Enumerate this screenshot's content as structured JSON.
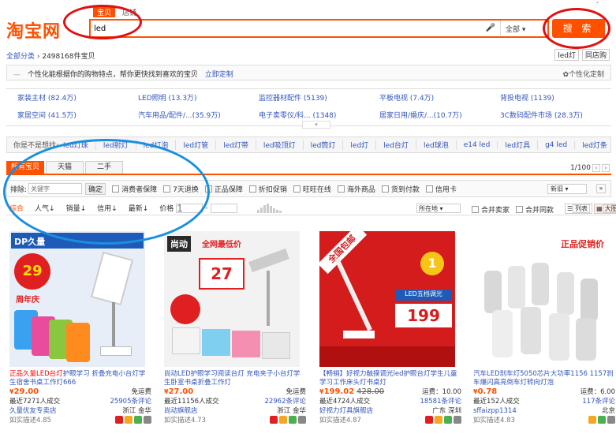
{
  "header": {
    "logo": "淘宝网",
    "search_tabs": [
      "宝贝",
      "店铺"
    ],
    "query": "led",
    "scope": "全部",
    "search_button": "搜 索"
  },
  "breadcrumb": {
    "root": "全部分类",
    "count": "2498168件宝贝"
  },
  "tags": [
    "led灯",
    "同店购"
  ],
  "personal": {
    "text": "个性化能根据你的购物特点，帮你更快找到喜欢的宝贝",
    "link": "立即定制",
    "right": "个性化定制"
  },
  "categories": [
    "家装主材 (82.4万)",
    "LED照明 (13.3万)",
    "监控器材配件 (5139)",
    "平板电视 (7.4万)",
    "背投电视 (1139)",
    "家居空间 (41.5万)",
    "汽车用品/配件/...(35.9万)",
    "电子卖零仪/科... (1348)",
    "居家日用/婚庆/...(10.7万)",
    "3C数码配件市场 (28.3万)"
  ],
  "suggest": {
    "label": "你是不是想找:",
    "items": [
      "led灯珠",
      "led射灯",
      "led灯泡",
      "led灯管",
      "led灯带",
      "led吸顶灯",
      "led筒灯",
      "led灯",
      "led台灯",
      "led球泡",
      "e14 led",
      "led灯具",
      "g4 led",
      "led灯条"
    ]
  },
  "result_tabs": [
    "所有宝贝",
    "天猫",
    "二手"
  ],
  "pager": "1/100",
  "filter": {
    "exclude_label": "排除:",
    "exclude_placeholder": "关键字",
    "ok": "确定",
    "options": [
      "消费者保障",
      "7天退换",
      "正品保障",
      "折扣促销",
      "旺旺在线",
      "海外商品",
      "货到付款",
      "信用卡"
    ],
    "new_old": "新旧"
  },
  "sort": {
    "items": [
      "综合",
      "人气",
      "销量",
      "信用",
      "最新"
    ],
    "price_label": "价格",
    "price_from": "1",
    "location": "所在地",
    "merge_seller": "合并卖家",
    "merge_same": "合并同款",
    "view_list": "列表",
    "view_big": "大图"
  },
  "products": [
    {
      "title_hl": "正品久量LED台灯",
      "title_rest": "护眼学习 折叠充电小台灯学生宿舍书桌工作灯666",
      "price": "29.00",
      "old_price": "",
      "shipping": "免运费",
      "sales": "最近7271人成交",
      "reviews": "25905条评论",
      "shop": "久量优友专卖店",
      "location": "浙江 金华",
      "rating": "如实描述4.85",
      "promo_badge": "29",
      "promo_text": "周年庆",
      "banner": "DP久量"
    },
    {
      "title_hl": "",
      "title_rest": "尚动LED护眼学习阅读台灯 充电夹子小台灯学生卧室书桌折叠工作灯",
      "price": "27.00",
      "old_price": "",
      "shipping": "免运费",
      "sales": "最近11156人成交",
      "reviews": "22962条评论",
      "shop": "尚动旗舰店",
      "location": "浙江 金华",
      "rating": "如实描述4.73",
      "promo_badge": "27",
      "promo_text": "全网最低价",
      "banner": "尚动"
    },
    {
      "title_hl": "",
      "title_rest": "【畅销】好视力触摸调光led护眼台灯学生儿童学习工作床头灯书桌灯",
      "price": "199.02",
      "old_price": "428.00",
      "shipping": "运费：10.00",
      "sales": "最近4724人成交",
      "reviews": "18581条评论",
      "shop": "好视力灯具旗舰店",
      "location": "广东 深圳",
      "rating": "如实描述4.87",
      "promo_badge": "199",
      "promo_text": "LED五档调光",
      "banner": "全国包邮"
    },
    {
      "title_hl": "",
      "title_rest": "汽车LED刹车灯5050芯片大功率1156 1157刹车爆闪高亮倒车灯转向灯泡",
      "price": "0.78",
      "old_price": "",
      "shipping": "运费：6.00",
      "sales": "最近152人成交",
      "reviews": "117条评论",
      "shop": "sffaizpp1314",
      "location": "北京",
      "rating": "如实描述4.83",
      "promo_badge": "",
      "promo_text": "正品促销价",
      "banner": ""
    }
  ]
}
